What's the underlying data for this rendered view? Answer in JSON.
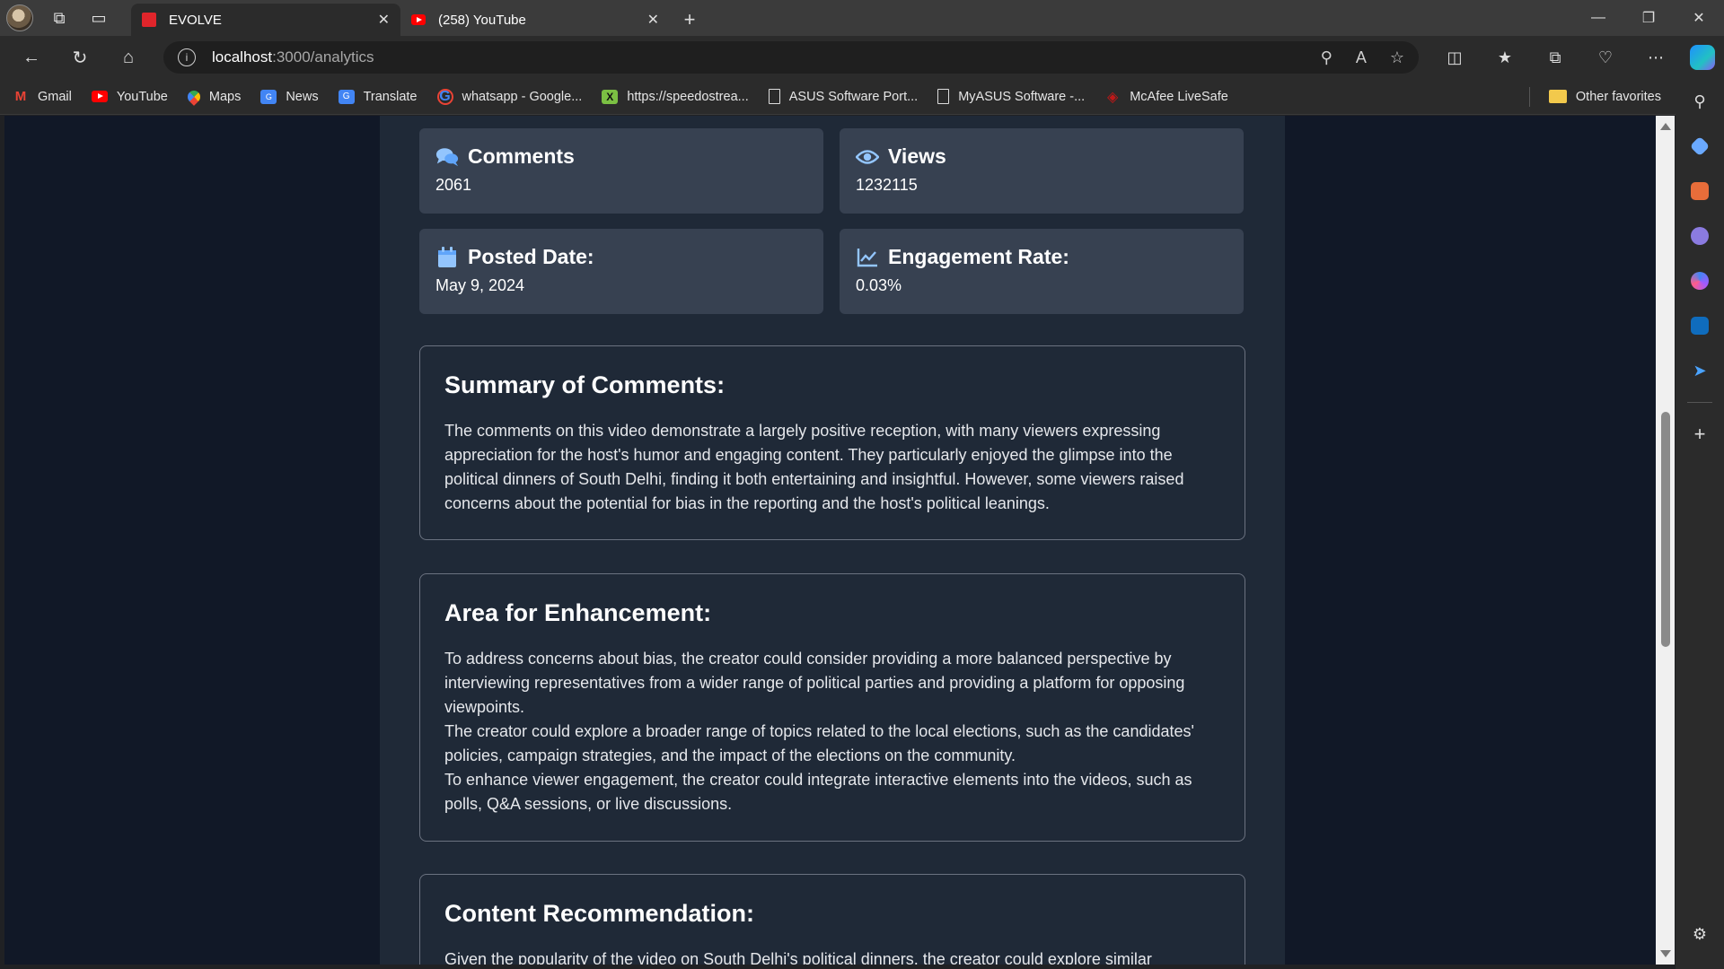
{
  "browser": {
    "tabs": [
      {
        "title": "EVOLVE",
        "active": true
      },
      {
        "title": "(258) YouTube",
        "active": false
      }
    ],
    "address": {
      "host": "localhost",
      "path": ":3000/analytics"
    },
    "bookmarks": [
      {
        "label": "Gmail",
        "icon": "gmail-icon"
      },
      {
        "label": "YouTube",
        "icon": "youtube-icon"
      },
      {
        "label": "Maps",
        "icon": "maps-icon"
      },
      {
        "label": "News",
        "icon": "news-icon"
      },
      {
        "label": "Translate",
        "icon": "translate-icon"
      },
      {
        "label": "whatsapp - Google...",
        "icon": "google-icon"
      },
      {
        "label": "https://speedostrea...",
        "icon": "x-icon"
      },
      {
        "label": "ASUS Software Port...",
        "icon": "document-icon"
      },
      {
        "label": "MyASUS Software -...",
        "icon": "document-icon"
      },
      {
        "label": "McAfee LiveSafe",
        "icon": "mcafee-icon"
      }
    ],
    "other_favorites": "Other favorites"
  },
  "stats": {
    "comments": {
      "label": "Comments",
      "value": "2061"
    },
    "views": {
      "label": "Views",
      "value": "1232115"
    },
    "posted": {
      "label": "Posted Date:",
      "value": "May 9, 2024"
    },
    "engagement": {
      "label": "Engagement Rate:",
      "value": "0.03%"
    }
  },
  "summary": {
    "title": "Summary of Comments:",
    "text": "The comments on this video demonstrate a largely positive reception, with many viewers expressing appreciation for the host's humor and engaging content. They particularly enjoyed the glimpse into the political dinners of South Delhi, finding it both entertaining and insightful. However, some viewers raised concerns about the potential for bias in the reporting and the host's political leanings."
  },
  "enhancement": {
    "title": "Area for Enhancement:",
    "points": [
      "To address concerns about bias, the creator could consider providing a more balanced perspective by interviewing representatives from a wider range of political parties and providing a platform for opposing viewpoints.",
      "The creator could explore a broader range of topics related to the local elections, such as the candidates' policies, campaign strategies, and the impact of the elections on the community.",
      "To enhance viewer engagement, the creator could integrate interactive elements into the videos, such as polls, Q&A sessions, or live discussions."
    ]
  },
  "recommendation": {
    "title": "Content Recommendation:",
    "text": "Given the popularity of the video on South Delhi's political dinners, the creator could explore similar"
  },
  "colors": {
    "page_bg": "#111827",
    "content_bg": "#1f2937",
    "card_bg": "#374151",
    "icon_accent": "#93c5fd"
  }
}
